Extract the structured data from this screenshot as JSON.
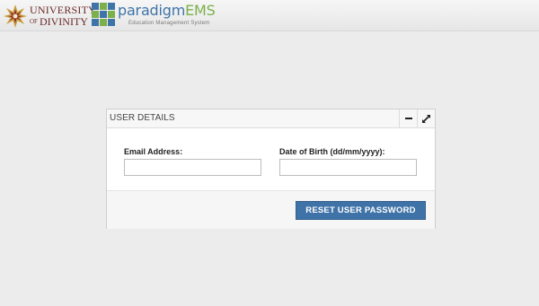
{
  "header": {
    "university_logo": {
      "line1": "UNIVERSITY",
      "of": "OF",
      "line2": "DIVINITY",
      "icon": "star-seal-icon",
      "colors": {
        "text": "#6b2a2a",
        "star_outer": "#c99a3c",
        "star_inner": "#8a2c2c"
      }
    },
    "paradigm_logo": {
      "brand_main": "paradigm",
      "brand_accent": "EMS",
      "subtitle": "Education Management System",
      "icon": "grid-squares-icon",
      "colors": {
        "blue": "#3f74a8",
        "green": "#7bb04a"
      }
    }
  },
  "panel": {
    "title": "USER DETAILS",
    "minimize_icon": "minus-icon",
    "expand_icon": "expand-arrows-icon",
    "email": {
      "label": "Email Address:",
      "value": "",
      "placeholder": ""
    },
    "dob": {
      "label": "Date of Birth (dd/mm/yyyy):",
      "value": "",
      "placeholder": ""
    },
    "reset_button": "RESET USER PASSWORD",
    "colors": {
      "button": "#3f73a8"
    }
  }
}
